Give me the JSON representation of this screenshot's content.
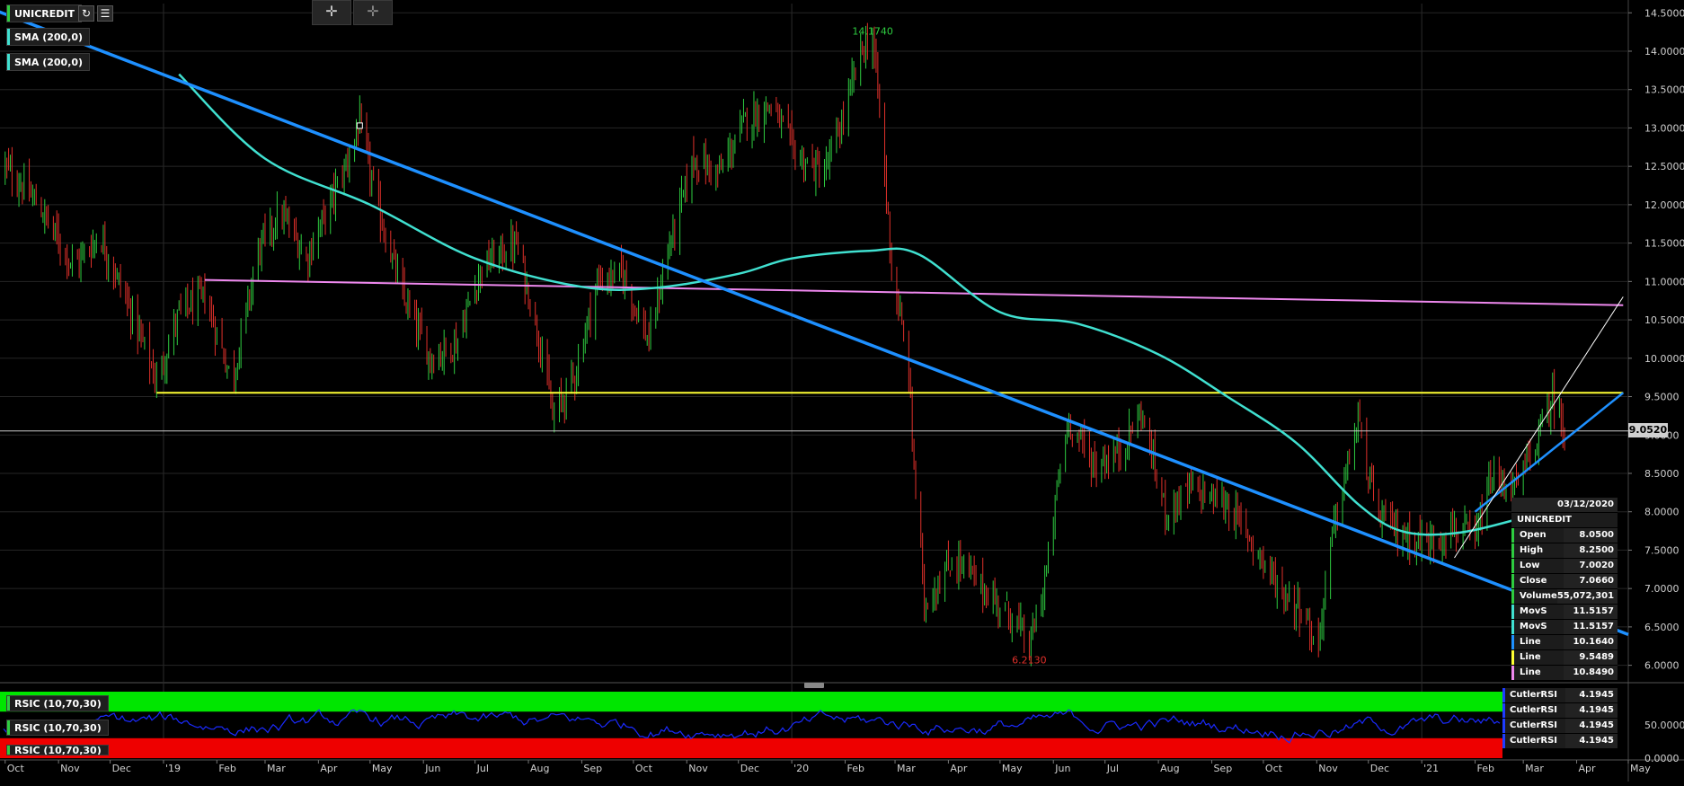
{
  "symbol": "UNICREDIT",
  "toolbar": {
    "refresh_icon": "refresh-icon",
    "menu_icon": "menu-icon",
    "crosshair_icon": "crosshair-icon",
    "crosshair_alt_icon": "crosshair-alt-icon"
  },
  "legend": {
    "symbol_label": "UNICREDIT",
    "sma1_label": "SMA (200,0)",
    "sma2_label": "SMA (200,0)"
  },
  "colors": {
    "background": "#000000",
    "up_bar": "#2ecc40",
    "down_bar": "#e0302a",
    "sma": "#40e0d0",
    "trendline": "#1e90ff",
    "support": "#ffff33",
    "resistance": "#ee88ee",
    "current_price_line": "#cccccc"
  },
  "chart_data": [
    {
      "type": "ohlc",
      "series_name": "UNICREDIT",
      "x_axis_ticks": [
        "Oct",
        "Nov",
        "Dec",
        "'19",
        "Feb",
        "Mar",
        "Apr",
        "May",
        "Jun",
        "Jul",
        "Aug",
        "Sep",
        "Oct",
        "Nov",
        "Dec",
        "'20",
        "Feb",
        "Mar",
        "Apr",
        "May",
        "Jun",
        "Jul",
        "Aug",
        "Sep",
        "Oct",
        "Nov",
        "Dec",
        "'21",
        "Feb",
        "Mar",
        "Apr",
        "May"
      ],
      "y_axis_ticks": [
        "14.5000",
        "14.0000",
        "13.5000",
        "13.0000",
        "12.5000",
        "12.0000",
        "11.5000",
        "11.0000",
        "10.5000",
        "10.0000",
        "9.5000",
        "9.0000",
        "8.5000",
        "8.0000",
        "7.5000",
        "7.0000",
        "6.5000",
        "6.0000"
      ],
      "ylim": [
        5.82,
        14.62
      ],
      "price_path": [
        [
          "2018-10-01",
          12.5
        ],
        [
          "2018-10-20",
          12.0
        ],
        [
          "2018-11-10",
          11.2
        ],
        [
          "2018-11-25",
          11.6
        ],
        [
          "2018-12-15",
          10.5
        ],
        [
          "2018-12-28",
          9.7
        ],
        [
          "2019-01-10",
          10.6
        ],
        [
          "2019-01-25",
          10.8
        ],
        [
          "2019-02-10",
          9.7
        ],
        [
          "2019-02-25",
          11.4
        ],
        [
          "2019-03-10",
          11.9
        ],
        [
          "2019-03-25",
          11.3
        ],
        [
          "2019-04-15",
          12.4
        ],
        [
          "2019-04-25",
          13.05
        ],
        [
          "2019-05-05",
          12.0
        ],
        [
          "2019-05-20",
          10.8
        ],
        [
          "2019-06-05",
          10.0
        ],
        [
          "2019-06-20",
          10.2
        ],
        [
          "2019-07-05",
          11.2
        ],
        [
          "2019-07-25",
          11.5
        ],
        [
          "2019-08-10",
          10.0
        ],
        [
          "2019-08-15",
          9.2
        ],
        [
          "2019-08-28",
          9.8
        ],
        [
          "2019-09-10",
          11.0
        ],
        [
          "2019-09-25",
          11.1
        ],
        [
          "2019-10-10",
          10.2
        ],
        [
          "2019-10-20",
          11.3
        ],
        [
          "2019-11-05",
          12.6
        ],
        [
          "2019-11-20",
          12.4
        ],
        [
          "2019-12-05",
          13.1
        ],
        [
          "2019-12-20",
          13.3
        ],
        [
          "2020-01-05",
          12.6
        ],
        [
          "2020-01-20",
          12.4
        ],
        [
          "2020-02-01",
          13.2
        ],
        [
          "2020-02-10",
          14.0
        ],
        [
          "2020-02-17",
          14.17
        ],
        [
          "2020-02-22",
          13.0
        ],
        [
          "2020-02-28",
          11.2
        ],
        [
          "2020-03-09",
          9.8
        ],
        [
          "2020-03-12",
          8.6
        ],
        [
          "2020-03-18",
          6.8
        ],
        [
          "2020-04-05",
          7.4
        ],
        [
          "2020-04-25",
          6.9
        ],
        [
          "2020-05-10",
          6.6
        ],
        [
          "2020-05-18",
          6.21
        ],
        [
          "2020-05-28",
          7.2
        ],
        [
          "2020-06-05",
          8.6
        ],
        [
          "2020-06-10",
          9.2
        ],
        [
          "2020-06-25",
          8.6
        ],
        [
          "2020-07-10",
          8.8
        ],
        [
          "2020-07-22",
          9.3
        ],
        [
          "2020-08-05",
          8.0
        ],
        [
          "2020-08-20",
          8.3
        ],
        [
          "2020-09-10",
          8.1
        ],
        [
          "2020-09-25",
          7.6
        ],
        [
          "2020-10-10",
          7.0
        ],
        [
          "2020-10-25",
          6.7
        ],
        [
          "2020-11-01",
          6.15
        ],
        [
          "2020-11-10",
          7.7
        ],
        [
          "2020-11-25",
          9.2
        ],
        [
          "2020-12-05",
          8.0
        ],
        [
          "2020-12-20",
          7.7
        ],
        [
          "2021-01-05",
          7.6
        ],
        [
          "2021-01-20",
          7.8
        ],
        [
          "2021-02-01",
          7.6
        ],
        [
          "2021-02-10",
          8.4
        ],
        [
          "2021-02-25",
          8.3
        ],
        [
          "2021-03-10",
          9.0
        ],
        [
          "2021-03-18",
          9.5
        ],
        [
          "2021-03-25",
          9.05
        ]
      ],
      "annotations": {
        "high_label": "14.1740",
        "low_label": "6.2130",
        "current_price": "9.0520"
      },
      "indicators": {
        "sma_200": [
          [
            "2019-01-10",
            13.7
          ],
          [
            "2019-03-01",
            12.6
          ],
          [
            "2019-05-01",
            12.0
          ],
          [
            "2019-07-01",
            11.3
          ],
          [
            "2019-09-01",
            10.93
          ],
          [
            "2019-10-15",
            10.92
          ],
          [
            "2019-12-01",
            11.1
          ],
          [
            "2020-01-01",
            11.3
          ],
          [
            "2020-02-15",
            11.4
          ],
          [
            "2020-03-15",
            11.35
          ],
          [
            "2020-05-01",
            10.6
          ],
          [
            "2020-06-15",
            10.45
          ],
          [
            "2020-08-01",
            10.05
          ],
          [
            "2020-09-10",
            9.5
          ],
          [
            "2020-10-20",
            8.9
          ],
          [
            "2020-11-25",
            8.1
          ],
          [
            "2020-12-20",
            7.75
          ],
          [
            "2021-01-20",
            7.72
          ],
          [
            "2021-02-25",
            7.9
          ],
          [
            "2021-03-25",
            8.1
          ]
        ],
        "trendline_main": [
          [
            "2018-09-15",
            14.62
          ],
          [
            "2021-05-01",
            6.4
          ]
        ],
        "trendline_recent": [
          [
            "2021-02-01",
            8.0
          ],
          [
            "2021-04-28",
            9.55
          ]
        ],
        "trendline_steep": [
          [
            "2021-01-20",
            7.4
          ],
          [
            "2021-04-28",
            10.8
          ]
        ],
        "support_line": [
          [
            "2018-12-28",
            9.55
          ],
          [
            "2021-04-28",
            9.55
          ]
        ],
        "resistance_line": [
          [
            "2019-01-25",
            11.02
          ],
          [
            "2021-04-28",
            10.69
          ]
        ],
        "current_price_line": 9.052
      }
    },
    {
      "type": "line",
      "series_name": "RSIC (10,70,30)",
      "y_axis_ticks": [
        "50.0000",
        "0.0000"
      ],
      "ylim": [
        0,
        100
      ],
      "overbought": 70,
      "oversold": 30
    }
  ],
  "info_panel": {
    "date": "03/12/2020",
    "title": "UNICREDIT",
    "rows": [
      {
        "label": "Open",
        "value": "8.0500",
        "color": "#2ecc40"
      },
      {
        "label": "High",
        "value": "8.2500",
        "color": "#2ecc40"
      },
      {
        "label": "Low",
        "value": "7.0020",
        "color": "#2ecc40"
      },
      {
        "label": "Close",
        "value": "7.0660",
        "color": "#2ecc40"
      },
      {
        "label": "Volume",
        "value": "55,072,301",
        "color": "#2ecc40"
      },
      {
        "label": "MovS",
        "value": "11.5157",
        "color": "#40e0d0"
      },
      {
        "label": "MovS",
        "value": "11.5157",
        "color": "#40e0d0"
      },
      {
        "label": "Line",
        "value": "10.1640",
        "color": "#1e90ff"
      },
      {
        "label": "Line",
        "value": "9.5489",
        "color": "#ffff33"
      },
      {
        "label": "Line",
        "value": "10.8490",
        "color": "#ee88ee"
      }
    ]
  },
  "rsi_legend": {
    "label1": "RSIC (10,70,30)",
    "label2": "RSIC (10,70,30)",
    "label3": "RSIC (10,70,30)"
  },
  "rsi_panel": {
    "rows": [
      {
        "label": "CutlerRSI",
        "value": "4.1945"
      },
      {
        "label": "CutlerRSI",
        "value": "4.1945"
      },
      {
        "label": "CutlerRSI",
        "value": "4.1945"
      },
      {
        "label": "CutlerRSI",
        "value": "4.1945"
      }
    ]
  }
}
